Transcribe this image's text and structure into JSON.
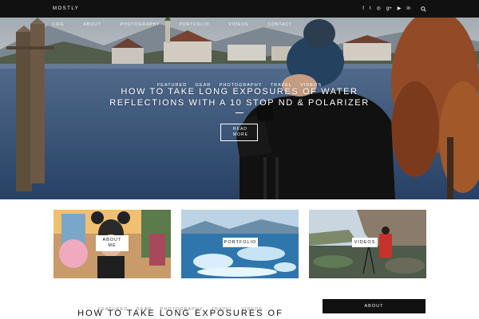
{
  "site": {
    "logo": "MOSTLY"
  },
  "social_icons": [
    "facebook-icon",
    "twitter-icon",
    "instagram-icon",
    "google-plus-icon",
    "youtube-icon",
    "linkedin-icon"
  ],
  "social_glyphs": [
    "f",
    "t",
    "◎",
    "g+",
    "▶",
    "in"
  ],
  "nav": [
    "LIFE",
    "ABOUT",
    "PHOTOGRAPHY",
    "PORTFOLIO",
    "VIDEOS",
    "CONTACT"
  ],
  "hero": {
    "categories": [
      "FEATURED",
      "GEAR",
      "PHOTOGRAPHY",
      "TRAVEL",
      "VIDEOS"
    ],
    "title_line1": "HOW TO TAKE LONG EXPOSURES OF WATER",
    "title_line2": "REFLECTIONS WITH A 10 STOP ND & POLARIZER",
    "read_more_line1": "READ",
    "read_more_line2": "MORE"
  },
  "tiles": [
    {
      "label_line1": "ABOUT",
      "label_line2": "ME"
    },
    {
      "label_line1": "PORTFOLIO",
      "label_line2": ""
    },
    {
      "label_line1": "VIDEOS",
      "label_line2": ""
    }
  ],
  "post": {
    "categories": [
      "FEATURED",
      "GEAR",
      "PHOTOGRAPHY",
      "TRAVEL",
      "VIDEOS"
    ],
    "title": "HOW TO TAKE LONG EXPOSURES OF"
  },
  "sidebar": {
    "about_heading": "ABOUT"
  },
  "colors": {
    "topbar": "#111111",
    "text": "#111111",
    "muted": "#888888"
  }
}
